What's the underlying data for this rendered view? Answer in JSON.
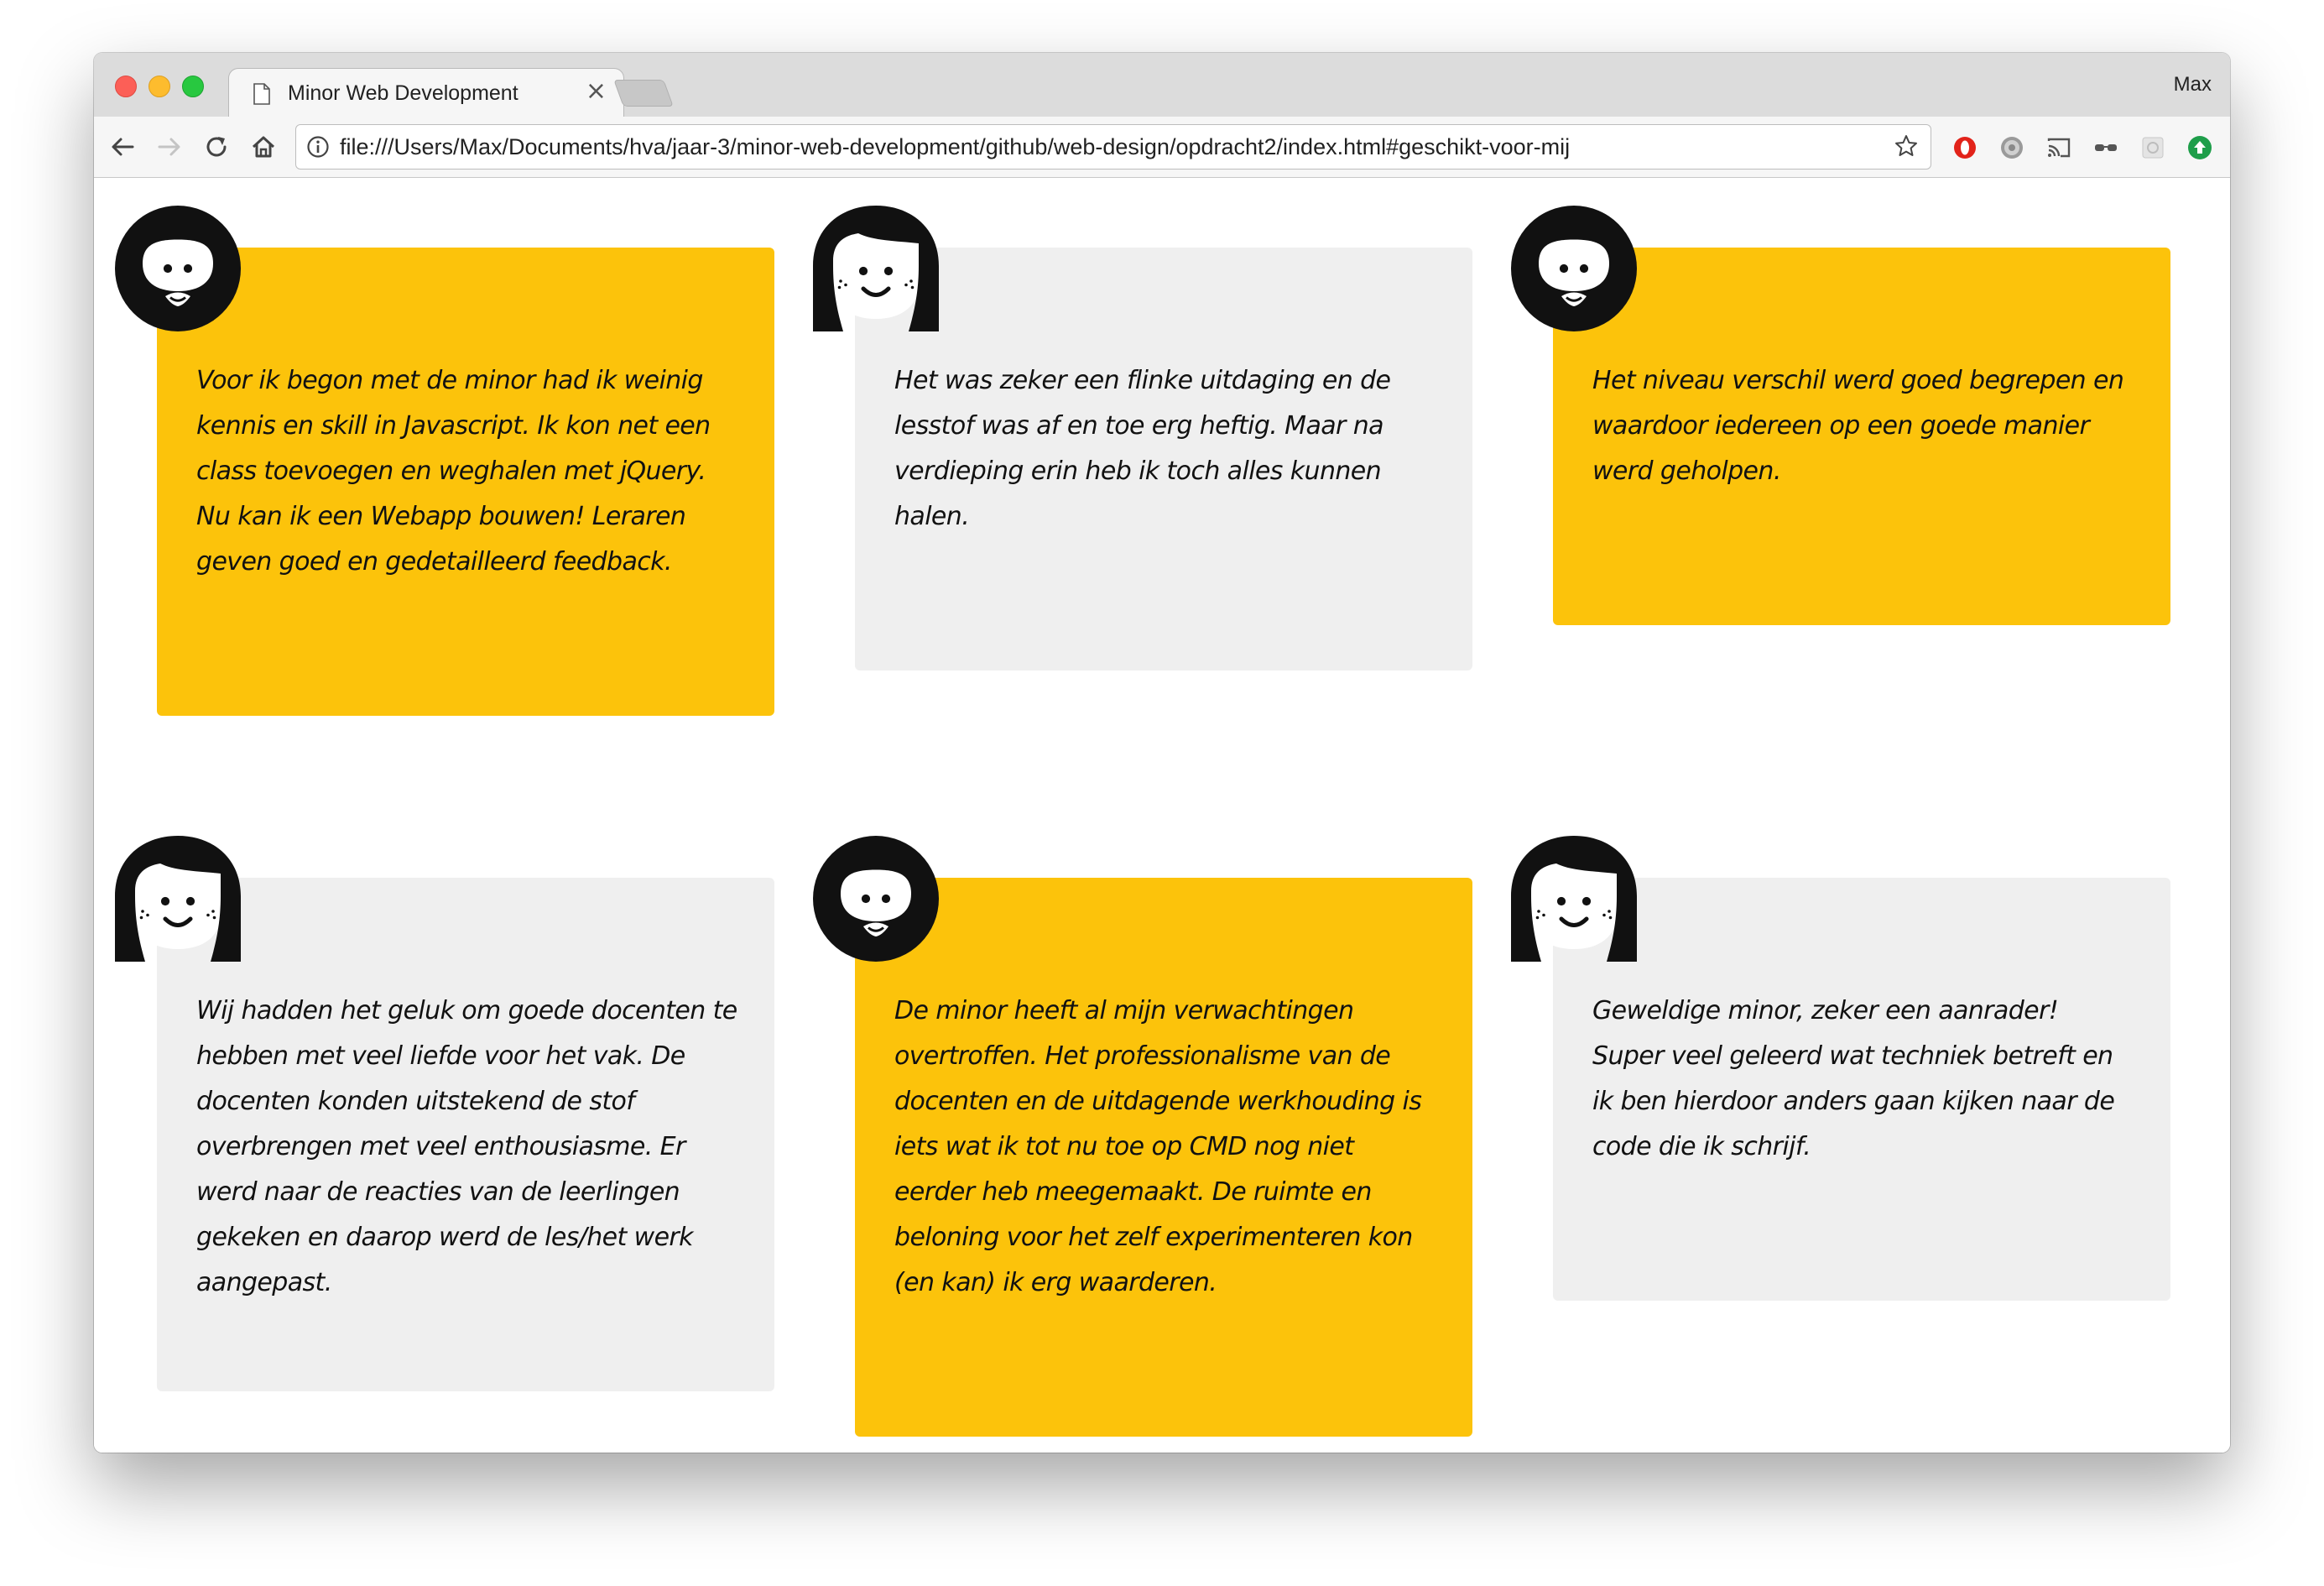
{
  "browser": {
    "tab_title": "Minor Web Development",
    "tab_close": "×",
    "user": "Max",
    "url": "file:///Users/Max/Documents/hva/jaar-3/minor-web-development/github/web-design/opdracht2/index.html#geschikt-voor-mij",
    "extensions": [
      "opera-icon",
      "gear-extension-icon",
      "cast-icon",
      "glasses-icon",
      "puzzle-extension-icon",
      "upload-icon"
    ]
  },
  "colors": {
    "accent_yellow": "#fcc30b",
    "card_grey": "#efefef",
    "text": "#111111"
  },
  "testimonials": [
    {
      "avatar": "bearded-man-avatar-icon",
      "style": "yellow",
      "text": "Voor ik begon met de minor had ik weinig kennis en skill in Javascript. Ik kon net een class toevoegen en weghalen met jQuery. Nu kan ik een Webapp bouwen! Leraren geven goed en gedetailleerd feedback."
    },
    {
      "avatar": "woman-avatar-icon",
      "style": "grey",
      "text": "Het was zeker een flinke uitdaging en de lesstof was af en toe erg heftig. Maar na verdieping erin heb ik toch alles kunnen halen."
    },
    {
      "avatar": "bearded-man-avatar-icon",
      "style": "yellow",
      "text": "Het niveau verschil werd goed begrepen en waardoor iedereen op een goede manier werd geholpen."
    },
    {
      "avatar": "woman-avatar-icon",
      "style": "grey",
      "text": "Wij hadden het geluk om goede docenten te hebben met veel liefde voor het vak. De docenten konden uitstekend de stof overbrengen met veel enthousiasme. Er werd naar de reacties van de leerlingen gekeken en daarop werd de les/het werk aangepast."
    },
    {
      "avatar": "bearded-man-avatar-icon",
      "style": "yellow",
      "text": "De minor heeft al mijn verwachtingen overtroffen. Het professionalisme van de docenten en de uitdagende werkhouding is iets wat ik tot nu toe op CMD nog niet eerder heb meegemaakt. De ruimte en beloning voor het zelf experimenteren kon (en kan) ik erg waarderen."
    },
    {
      "avatar": "woman-avatar-icon",
      "style": "grey",
      "text": "Geweldige minor, zeker een aanrader! Super veel geleerd wat techniek betreft en ik ben hierdoor anders gaan kijken naar de code die ik schrijf."
    }
  ]
}
